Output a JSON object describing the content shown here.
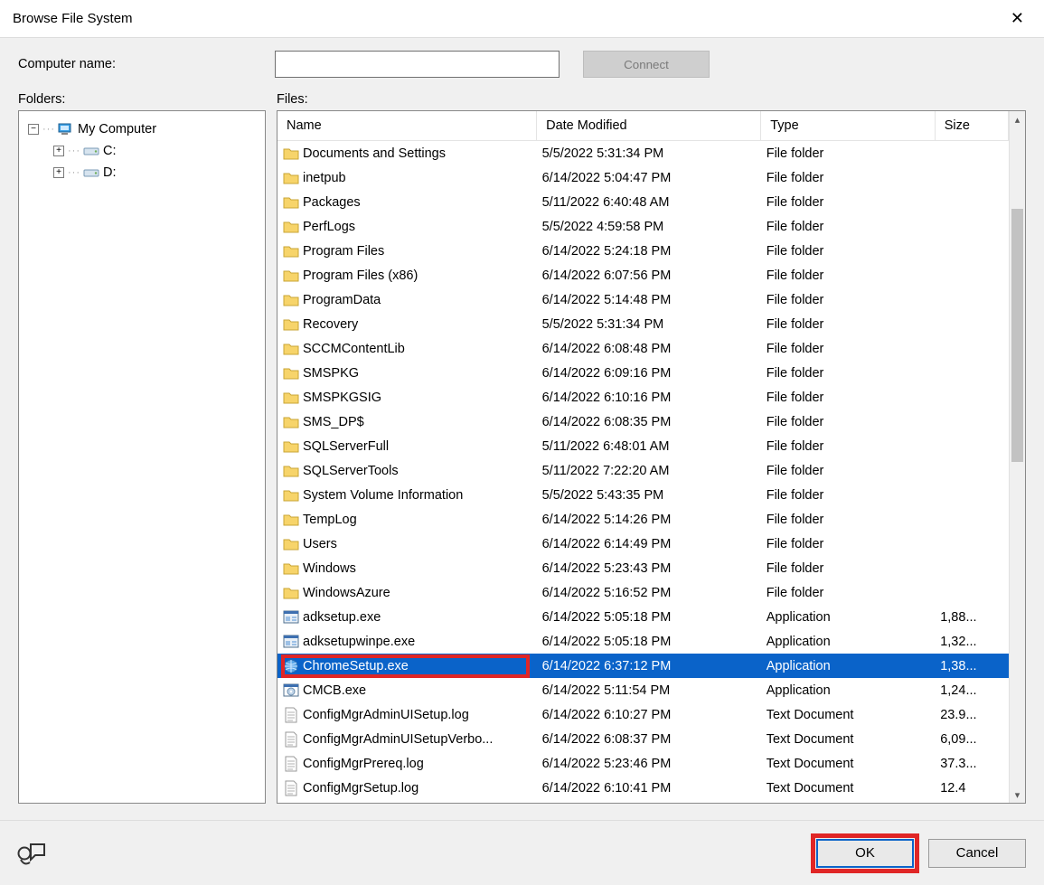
{
  "window": {
    "title": "Browse File System",
    "close_glyph": "✕"
  },
  "top": {
    "computer_name_label": "Computer name:",
    "computer_name_value": "",
    "connect_label": "Connect"
  },
  "labels": {
    "folders": "Folders:",
    "files": "Files:"
  },
  "tree": {
    "root": {
      "label": "My Computer",
      "expanded": true
    },
    "drives": [
      {
        "label": "C:",
        "expanded": false
      },
      {
        "label": "D:",
        "expanded": false
      }
    ]
  },
  "columns": {
    "name": "Name",
    "date": "Date Modified",
    "type": "Type",
    "size": "Size"
  },
  "files": [
    {
      "name": "Documents and Settings",
      "date": "5/5/2022 5:31:34 PM",
      "type": "File folder",
      "size": "",
      "icon": "folder"
    },
    {
      "name": "inetpub",
      "date": "6/14/2022 5:04:47 PM",
      "type": "File folder",
      "size": "",
      "icon": "folder"
    },
    {
      "name": "Packages",
      "date": "5/11/2022 6:40:48 AM",
      "type": "File folder",
      "size": "",
      "icon": "folder"
    },
    {
      "name": "PerfLogs",
      "date": "5/5/2022 4:59:58 PM",
      "type": "File folder",
      "size": "",
      "icon": "folder"
    },
    {
      "name": "Program Files",
      "date": "6/14/2022 5:24:18 PM",
      "type": "File folder",
      "size": "",
      "icon": "folder"
    },
    {
      "name": "Program Files (x86)",
      "date": "6/14/2022 6:07:56 PM",
      "type": "File folder",
      "size": "",
      "icon": "folder"
    },
    {
      "name": "ProgramData",
      "date": "6/14/2022 5:14:48 PM",
      "type": "File folder",
      "size": "",
      "icon": "folder"
    },
    {
      "name": "Recovery",
      "date": "5/5/2022 5:31:34 PM",
      "type": "File folder",
      "size": "",
      "icon": "folder"
    },
    {
      "name": "SCCMContentLib",
      "date": "6/14/2022 6:08:48 PM",
      "type": "File folder",
      "size": "",
      "icon": "folder"
    },
    {
      "name": "SMSPKG",
      "date": "6/14/2022 6:09:16 PM",
      "type": "File folder",
      "size": "",
      "icon": "folder"
    },
    {
      "name": "SMSPKGSIG",
      "date": "6/14/2022 6:10:16 PM",
      "type": "File folder",
      "size": "",
      "icon": "folder"
    },
    {
      "name": "SMS_DP$",
      "date": "6/14/2022 6:08:35 PM",
      "type": "File folder",
      "size": "",
      "icon": "folder"
    },
    {
      "name": "SQLServerFull",
      "date": "5/11/2022 6:48:01 AM",
      "type": "File folder",
      "size": "",
      "icon": "folder"
    },
    {
      "name": "SQLServerTools",
      "date": "5/11/2022 7:22:20 AM",
      "type": "File folder",
      "size": "",
      "icon": "folder"
    },
    {
      "name": "System Volume Information",
      "date": "5/5/2022 5:43:35 PM",
      "type": "File folder",
      "size": "",
      "icon": "folder"
    },
    {
      "name": "TempLog",
      "date": "6/14/2022 5:14:26 PM",
      "type": "File folder",
      "size": "",
      "icon": "folder"
    },
    {
      "name": "Users",
      "date": "6/14/2022 6:14:49 PM",
      "type": "File folder",
      "size": "",
      "icon": "folder"
    },
    {
      "name": "Windows",
      "date": "6/14/2022 5:23:43 PM",
      "type": "File folder",
      "size": "",
      "icon": "folder"
    },
    {
      "name": "WindowsAzure",
      "date": "6/14/2022 5:16:52 PM",
      "type": "File folder",
      "size": "",
      "icon": "folder"
    },
    {
      "name": "adksetup.exe",
      "date": "6/14/2022 5:05:18 PM",
      "type": "Application",
      "size": "1,88...",
      "icon": "exe"
    },
    {
      "name": "adksetupwinpe.exe",
      "date": "6/14/2022 5:05:18 PM",
      "type": "Application",
      "size": "1,32...",
      "icon": "exe"
    },
    {
      "name": "ChromeSetup.exe",
      "date": "6/14/2022 6:37:12 PM",
      "type": "Application",
      "size": "1,38...",
      "icon": "exe-globe",
      "selected": true,
      "highlight": true
    },
    {
      "name": "CMCB.exe",
      "date": "6/14/2022 5:11:54 PM",
      "type": "Application",
      "size": "1,24...",
      "icon": "exe-disc"
    },
    {
      "name": "ConfigMgrAdminUISetup.log",
      "date": "6/14/2022 6:10:27 PM",
      "type": "Text Document",
      "size": "23.9...",
      "icon": "txt"
    },
    {
      "name": "ConfigMgrAdminUISetupVerbo...",
      "date": "6/14/2022 6:08:37 PM",
      "type": "Text Document",
      "size": "6,09...",
      "icon": "txt"
    },
    {
      "name": "ConfigMgrPrereq.log",
      "date": "6/14/2022 5:23:46 PM",
      "type": "Text Document",
      "size": "37.3...",
      "icon": "txt"
    },
    {
      "name": "ConfigMgrSetup.log",
      "date": "6/14/2022 6:10:41 PM",
      "type": "Text Document",
      "size": "12.4",
      "icon": "txt"
    }
  ],
  "footer": {
    "ok": "OK",
    "cancel": "Cancel"
  }
}
